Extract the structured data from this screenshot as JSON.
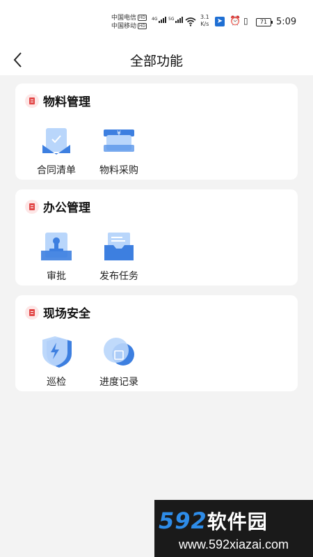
{
  "status_bar": {
    "carrier_1": "中国电信",
    "carrier_2": "中国移动",
    "hd_badge": "HD",
    "signal_1_tag": "4G",
    "signal_2_tag": "5G",
    "net_speed_value": "3.1",
    "net_speed_unit": "K/s",
    "battery_level": "71",
    "time": "5:09",
    "icons": [
      "wifi-icon",
      "app-badge-icon",
      "alarm-icon",
      "vibrate-icon",
      "battery-icon"
    ]
  },
  "header": {
    "title": "全部功能",
    "back_icon": "chevron-left-icon"
  },
  "sections": [
    {
      "title": "物料管理",
      "items": [
        {
          "label": "合同清单",
          "icon": "contract-list-icon"
        },
        {
          "label": "物料采购",
          "icon": "material-purchase-icon"
        }
      ]
    },
    {
      "title": "办公管理",
      "items": [
        {
          "label": "审批",
          "icon": "approval-stamp-icon"
        },
        {
          "label": "发布任务",
          "icon": "publish-task-icon"
        }
      ]
    },
    {
      "title": "现场安全",
      "items": [
        {
          "label": "巡检",
          "icon": "inspection-shield-icon"
        },
        {
          "label": "进度记录",
          "icon": "progress-record-icon"
        }
      ]
    }
  ],
  "watermark": {
    "brand": "592",
    "brand_suffix": "软件园",
    "url": "www.592xiazai.com"
  },
  "colors": {
    "accent_blue": "#4a8fe8",
    "section_icon_red": "#e24848",
    "background": "#f3f3f3"
  }
}
